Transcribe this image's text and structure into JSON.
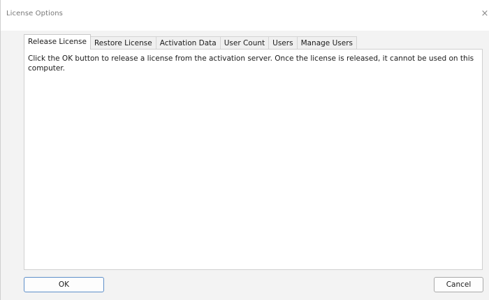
{
  "window": {
    "title": "License Options",
    "close_glyph": "×"
  },
  "tabs": [
    {
      "label": "Release License",
      "active": true
    },
    {
      "label": "Restore License",
      "active": false
    },
    {
      "label": "Activation Data",
      "active": false
    },
    {
      "label": "User Count",
      "active": false
    },
    {
      "label": "Users",
      "active": false
    },
    {
      "label": "Manage Users",
      "active": false
    }
  ],
  "panel": {
    "message": "Click the OK button to release a license from the activation server.  Once the license is released, it cannot be used on this computer."
  },
  "buttons": {
    "ok_label": "OK",
    "cancel_label": "Cancel"
  },
  "icons": {
    "close": "close-icon"
  },
  "colors": {
    "dialog_bg": "#f3f3f3",
    "panel_bg": "#ffffff",
    "ok_focus_border": "#5e8fc9"
  }
}
